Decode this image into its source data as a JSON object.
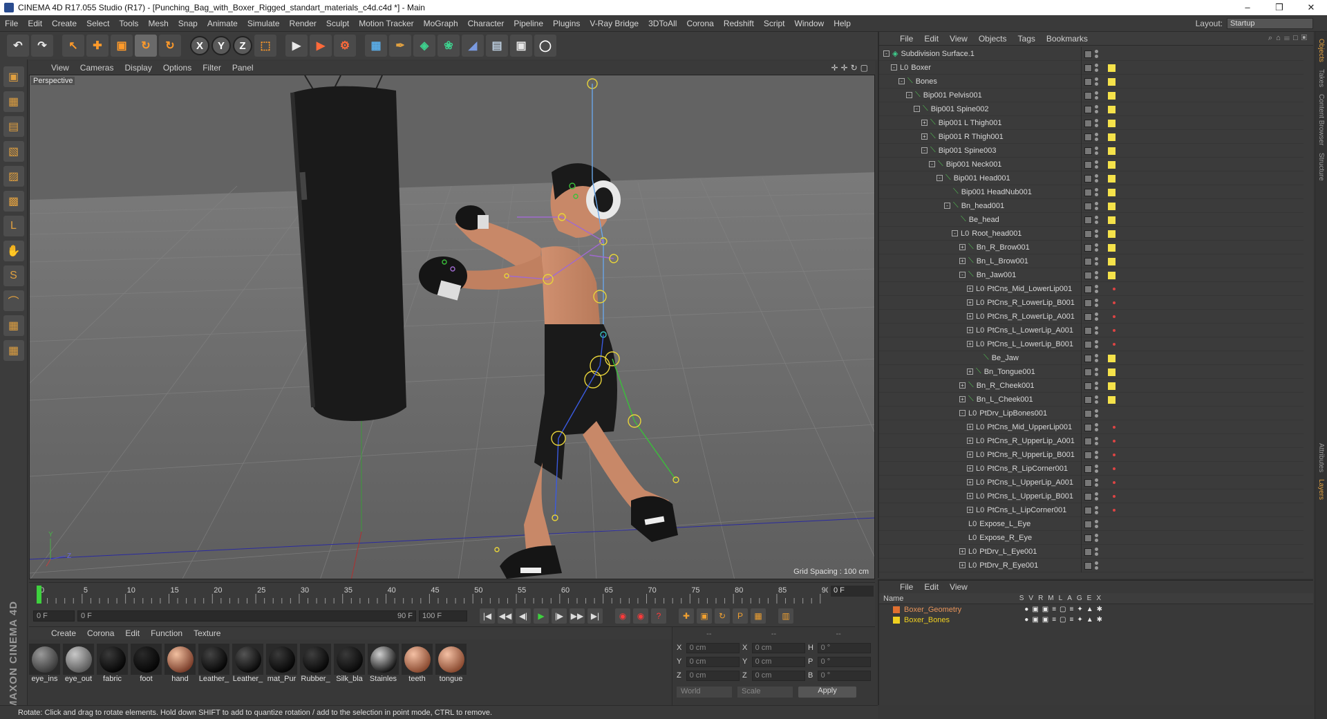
{
  "titlebar": {
    "title": "CINEMA 4D R17.055 Studio (R17) - [Punching_Bag_with_Boxer_Rigged_standart_materials_c4d.c4d *] - Main",
    "min": "–",
    "max": "❒",
    "close": "✕"
  },
  "menubar": {
    "items": [
      "File",
      "Edit",
      "Create",
      "Select",
      "Tools",
      "Mesh",
      "Snap",
      "Animate",
      "Simulate",
      "Render",
      "Sculpt",
      "Motion Tracker",
      "MoGraph",
      "Character",
      "Pipeline",
      "Plugins",
      "V-Ray Bridge",
      "3DToAll",
      "Corona",
      "Redshift",
      "Script",
      "Window",
      "Help"
    ],
    "layout_label": "Layout:",
    "layout_value": "Startup"
  },
  "toptools": {
    "undo": "↶",
    "redo": "↷",
    "select": "↖",
    "move": "✚",
    "scale": "▣",
    "rotate": "↻",
    "recent": "↻",
    "x": "X",
    "y": "Y",
    "z": "Z",
    "coord": "⬚",
    "render_view": "▶",
    "render_pic": "▶",
    "render_settings": "⚙",
    "cube": "▦",
    "pen": "✒",
    "subdiv": "◈",
    "cloner": "❀",
    "deformer": "◢",
    "floor": "▤",
    "camera": "▣",
    "light": "◯"
  },
  "lefttools": {
    "items": [
      "▣",
      "▦",
      "▤",
      "▧",
      "▨",
      "▩",
      "L",
      "✋",
      "S",
      "⌒",
      "▦",
      "▦"
    ],
    "brand": "MAXON CINEMA 4D"
  },
  "viewport": {
    "menu": [
      "View",
      "Cameras",
      "Display",
      "Options",
      "Filter",
      "Panel"
    ],
    "navicons": "✛✛↻▢",
    "camera": "Perspective",
    "grid_info": "Grid Spacing : 100 cm",
    "axis_x": "Z",
    "axis_y": "Y"
  },
  "timeline": {
    "labels": [
      "0",
      "5",
      "10",
      "15",
      "20",
      "25",
      "30",
      "35",
      "40",
      "45",
      "50",
      "55",
      "60",
      "65",
      "70",
      "75",
      "80",
      "85",
      "90"
    ],
    "current_frame": "0 F"
  },
  "transport": {
    "start_field": "0 F",
    "range_field": "0 F",
    "range_end": "90 F",
    "end_field": "100 F",
    "btn_first": "|◀",
    "btn_prevkey": "◀◀",
    "btn_prev": "◀|",
    "btn_play": "▶",
    "btn_next": "|▶",
    "btn_nextkey": "▶▶",
    "btn_last": "▶|",
    "btn_record": "◉",
    "btn_autokey": "◉",
    "btn_keysel": "?",
    "btn_move": "✚",
    "btn_scale": "▣",
    "btn_rot": "↻",
    "btn_param": "P",
    "btn_pla": "▦",
    "btn_dope": "▥"
  },
  "matmgr": {
    "menu": [
      "Create",
      "Corona",
      "Edit",
      "Function",
      "Texture"
    ],
    "materials": [
      {
        "label": "eye_ins",
        "c1": "#9a9a9a",
        "c2": "#3a3a3a"
      },
      {
        "label": "eye_out",
        "c1": "#c8c8c8",
        "c2": "#5a5a5a"
      },
      {
        "label": "fabric",
        "c1": "#3a3a3a",
        "c2": "#050505"
      },
      {
        "label": "foot",
        "c1": "#2a2a2a",
        "c2": "#050505"
      },
      {
        "label": "hand",
        "c1": "#f2c0a0",
        "c2": "#7a3d2a"
      },
      {
        "label": "Leather_",
        "c1": "#444444",
        "c2": "#050505"
      },
      {
        "label": "Leather_",
        "c1": "#555555",
        "c2": "#080808"
      },
      {
        "label": "mat_Pur",
        "c1": "#3a3a3a",
        "c2": "#050505"
      },
      {
        "label": "Rubber_",
        "c1": "#3f3f3f",
        "c2": "#060606"
      },
      {
        "label": "Silk_bla",
        "c1": "#3a3a3a",
        "c2": "#080808"
      },
      {
        "label": "Stainles",
        "c1": "#cfcfcf",
        "c2": "#151515"
      },
      {
        "label": "teeth",
        "c1": "#f4c0a4",
        "c2": "#8a4a30"
      },
      {
        "label": "tongue",
        "c1": "#f4c0a4",
        "c2": "#8a4a30"
      }
    ]
  },
  "coords": {
    "headers": [
      "--",
      "--",
      "--"
    ],
    "rows": [
      {
        "a1": "X",
        "v1": "0 cm",
        "a2": "X",
        "v2": "0 cm",
        "a3": "H",
        "v3": "0 °"
      },
      {
        "a1": "Y",
        "v1": "0 cm",
        "a2": "Y",
        "v2": "0 cm",
        "a3": "P",
        "v3": "0 °"
      },
      {
        "a1": "Z",
        "v1": "0 cm",
        "a2": "Z",
        "v2": "0 cm",
        "a3": "B",
        "v3": "0 °"
      }
    ],
    "world": "World",
    "scale": "Scale",
    "apply": "Apply"
  },
  "status": "Rotate: Click and drag to rotate elements. Hold down SHIFT to add to quantize rotation / add to the selection in point mode, CTRL to remove.",
  "objmgr": {
    "menu": [
      "File",
      "Edit",
      "View",
      "Objects",
      "Tags",
      "Bookmarks"
    ],
    "icons": "⌕⌂☰□▣",
    "rows": [
      {
        "name": "Subdivision Surface.1",
        "depth": 0,
        "exp": "-",
        "icon": "◈",
        "kind": "subd",
        "tag": "check"
      },
      {
        "name": "Boxer",
        "depth": 1,
        "exp": "-",
        "icon": "L0",
        "kind": "null",
        "tag": "yellow"
      },
      {
        "name": "Bones",
        "depth": 2,
        "exp": "-",
        "icon": "⟍",
        "kind": "bone",
        "tag": "yellow"
      },
      {
        "name": "Bip001 Pelvis001",
        "depth": 3,
        "exp": "-",
        "icon": "⟍",
        "kind": "bone",
        "tag": "yellow"
      },
      {
        "name": "Bip001 Spine002",
        "depth": 4,
        "exp": "-",
        "icon": "⟍",
        "kind": "bone",
        "tag": "yellow"
      },
      {
        "name": "Bip001 L Thigh001",
        "depth": 5,
        "exp": "+",
        "icon": "⟍",
        "kind": "bone",
        "tag": "yellow"
      },
      {
        "name": "Bip001 R Thigh001",
        "depth": 5,
        "exp": "+",
        "icon": "⟍",
        "kind": "bone",
        "tag": "yellow"
      },
      {
        "name": "Bip001 Spine003",
        "depth": 5,
        "exp": "-",
        "icon": "⟍",
        "kind": "bone",
        "tag": "yellow"
      },
      {
        "name": "Bip001 Neck001",
        "depth": 6,
        "exp": "-",
        "icon": "⟍",
        "kind": "bone",
        "tag": "yellow"
      },
      {
        "name": "Bip001 Head001",
        "depth": 7,
        "exp": "-",
        "icon": "⟍",
        "kind": "bone",
        "tag": "yellow"
      },
      {
        "name": "Bip001 HeadNub001",
        "depth": 8,
        "exp": "",
        "icon": "⟍",
        "kind": "bone",
        "tag": "yellow"
      },
      {
        "name": "Bn_head001",
        "depth": 8,
        "exp": "-",
        "icon": "⟍",
        "kind": "bone",
        "tag": "yellow"
      },
      {
        "name": "Be_head",
        "depth": 9,
        "exp": "",
        "icon": "⟍",
        "kind": "bone",
        "tag": "yellow"
      },
      {
        "name": "Root_head001",
        "depth": 9,
        "exp": "-",
        "icon": "L0",
        "kind": "null",
        "tag": "yellow"
      },
      {
        "name": "Bn_R_Brow001",
        "depth": 10,
        "exp": "+",
        "icon": "⟍",
        "kind": "bone",
        "tag": "yellow"
      },
      {
        "name": "Bn_L_Brow001",
        "depth": 10,
        "exp": "+",
        "icon": "⟍",
        "kind": "bone",
        "tag": "yellow"
      },
      {
        "name": "Bn_Jaw001",
        "depth": 10,
        "exp": "-",
        "icon": "⟍",
        "kind": "bone",
        "tag": "yellow"
      },
      {
        "name": "PtCns_Mid_LowerLip001",
        "depth": 11,
        "exp": "+",
        "icon": "L0",
        "kind": "null",
        "tag": "red"
      },
      {
        "name": "PtCns_R_LowerLip_B001",
        "depth": 11,
        "exp": "+",
        "icon": "L0",
        "kind": "null",
        "tag": "red"
      },
      {
        "name": "PtCns_R_LowerLip_A001",
        "depth": 11,
        "exp": "+",
        "icon": "L0",
        "kind": "null",
        "tag": "red"
      },
      {
        "name": "PtCns_L_LowerLip_A001",
        "depth": 11,
        "exp": "+",
        "icon": "L0",
        "kind": "null",
        "tag": "red"
      },
      {
        "name": "PtCns_L_LowerLip_B001",
        "depth": 11,
        "exp": "+",
        "icon": "L0",
        "kind": "null",
        "tag": "red"
      },
      {
        "name": "Be_Jaw",
        "depth": 12,
        "exp": "",
        "icon": "⟍",
        "kind": "bone",
        "tag": "yellow"
      },
      {
        "name": "Bn_Tongue001",
        "depth": 11,
        "exp": "+",
        "icon": "⟍",
        "kind": "bone",
        "tag": "yellow"
      },
      {
        "name": "Bn_R_Cheek001",
        "depth": 10,
        "exp": "+",
        "icon": "⟍",
        "kind": "bone",
        "tag": "yellow"
      },
      {
        "name": "Bn_L_Cheek001",
        "depth": 10,
        "exp": "+",
        "icon": "⟍",
        "kind": "bone",
        "tag": "yellow"
      },
      {
        "name": "PtDrv_LipBones001",
        "depth": 10,
        "exp": "-",
        "icon": "L0",
        "kind": "null",
        "tag": "none"
      },
      {
        "name": "PtCns_Mid_UpperLip001",
        "depth": 11,
        "exp": "+",
        "icon": "L0",
        "kind": "null",
        "tag": "red"
      },
      {
        "name": "PtCns_R_UpperLip_A001",
        "depth": 11,
        "exp": "+",
        "icon": "L0",
        "kind": "null",
        "tag": "red"
      },
      {
        "name": "PtCns_R_UpperLip_B001",
        "depth": 11,
        "exp": "+",
        "icon": "L0",
        "kind": "null",
        "tag": "red"
      },
      {
        "name": "PtCns_R_LipCorner001",
        "depth": 11,
        "exp": "+",
        "icon": "L0",
        "kind": "null",
        "tag": "red"
      },
      {
        "name": "PtCns_L_UpperLip_A001",
        "depth": 11,
        "exp": "+",
        "icon": "L0",
        "kind": "null",
        "tag": "red"
      },
      {
        "name": "PtCns_L_UpperLip_B001",
        "depth": 11,
        "exp": "+",
        "icon": "L0",
        "kind": "null",
        "tag": "red"
      },
      {
        "name": "PtCns_L_LipCorner001",
        "depth": 11,
        "exp": "+",
        "icon": "L0",
        "kind": "null",
        "tag": "red"
      },
      {
        "name": "Expose_L_Eye",
        "depth": 10,
        "exp": "",
        "icon": "L0",
        "kind": "null",
        "tag": "none"
      },
      {
        "name": "Expose_R_Eye",
        "depth": 10,
        "exp": "",
        "icon": "L0",
        "kind": "null",
        "tag": "none"
      },
      {
        "name": "PtDrv_L_Eye001",
        "depth": 10,
        "exp": "+",
        "icon": "L0",
        "kind": "null",
        "tag": "none"
      },
      {
        "name": "PtDrv_R_Eye001",
        "depth": 10,
        "exp": "+",
        "icon": "L0",
        "kind": "null",
        "tag": "none"
      }
    ]
  },
  "rightstrip": {
    "tabs": [
      "Objects",
      "Takes",
      "Content Browser",
      "Structure",
      "Attributes",
      "Layers"
    ]
  },
  "layermgr": {
    "menu": [
      "File",
      "Edit",
      "View"
    ],
    "name_col": "Name",
    "cols": "SVRMLAGEX",
    "layers": [
      {
        "name": "Boxer_Geometry",
        "color": "#e07030",
        "text": "#e8945a"
      },
      {
        "name": "Boxer_Bones",
        "color": "#f0d020",
        "text": "#f0d020"
      }
    ],
    "layer_icons": "●▣▣≡▢≡✦▲✱"
  }
}
